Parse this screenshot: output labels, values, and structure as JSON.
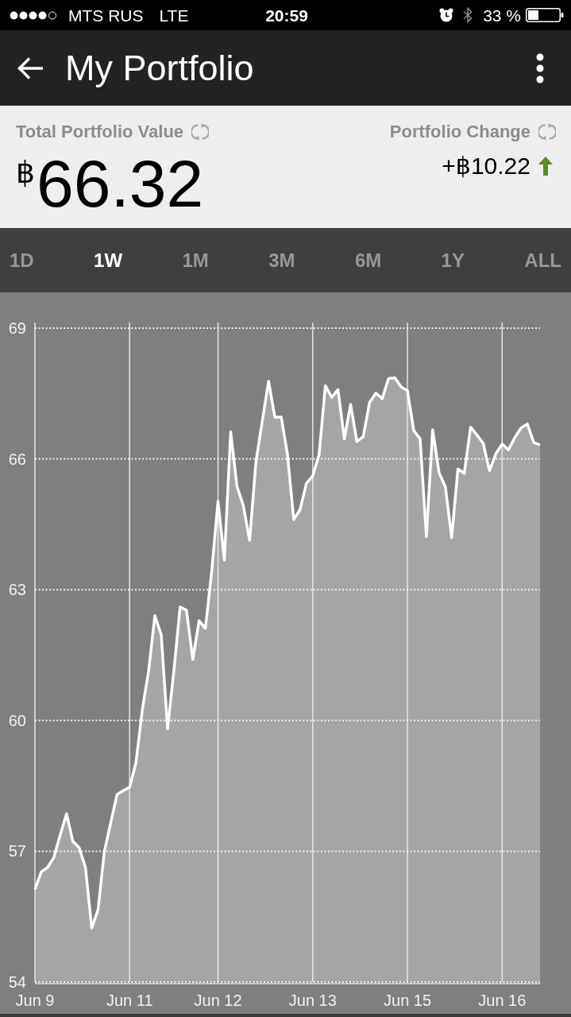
{
  "status_bar": {
    "carrier": "MTS RUS",
    "network": "LTE",
    "time": "20:59",
    "battery": "33 %"
  },
  "app_bar": {
    "title": "My Portfolio"
  },
  "summary": {
    "total": {
      "label": "Total Portfolio Value",
      "value": "$^{฿}$66.32"
    },
    "change": {
      "label": "Portfolio Change",
      "value": "+฿10.22"
    }
  },
  "range_tabs": [
    {
      "label": "1D",
      "selected": false
    },
    {
      "label": "1W",
      "selected": true
    },
    {
      "label": "1M",
      "selected": false
    },
    {
      "label": "3M",
      "selected": false
    },
    {
      "label": "6M",
      "selected": false
    },
    {
      "label": "1Y",
      "selected": false
    },
    {
      "label": "ALL",
      "selected": false
    }
  ],
  "chart": {
    "chart_data": {
      "type": "area",
      "grid": true,
      "categories": [
        "Jun 9",
        null,
        null,
        null,
        null,
        null,
        null,
        null,
        null,
        null,
        null,
        null,
        null,
        null,
        null,
        "Jun 11",
        null,
        null,
        null,
        null,
        null,
        null,
        null,
        null,
        null,
        null,
        null,
        null,
        null,
        "Jun 12",
        null,
        null,
        null,
        null,
        null,
        null,
        null,
        null,
        null,
        null,
        null,
        null,
        null,
        null,
        "Jun 13",
        null,
        null,
        null,
        null,
        null,
        null,
        null,
        null,
        null,
        null,
        null,
        null,
        null,
        null,
        "Jun 15",
        null,
        null,
        null,
        null,
        null,
        null,
        null,
        null,
        null,
        null,
        null,
        null,
        null,
        null,
        "Jun 16",
        null,
        null,
        null,
        null,
        null,
        null
      ],
      "series": [
        {
          "color": "#ffffff",
          "values": [
            56.12,
            56.53,
            56.63,
            56.86,
            57.37,
            57.86,
            57.23,
            57.08,
            56.63,
            55.24,
            55.66,
            56.99,
            57.65,
            58.3,
            58.39,
            58.47,
            59.03,
            60.25,
            61.13,
            62.4,
            61.97,
            59.81,
            61.13,
            62.6,
            62.53,
            61.4,
            62.29,
            62.11,
            63.42,
            65.03,
            63.68,
            66.62,
            65.37,
            64.94,
            64.13,
            65.94,
            66.86,
            67.78,
            66.96,
            66.96,
            66.1,
            64.61,
            64.84,
            65.44,
            65.61,
            66.1,
            67.68,
            67.41,
            67.59,
            66.46,
            67.25,
            66.4,
            66.51,
            67.29,
            67.51,
            67.38,
            67.84,
            67.86,
            67.65,
            67.57,
            66.65,
            66.46,
            64.22,
            66.67,
            65.69,
            65.36,
            64.19,
            65.77,
            65.67,
            66.73,
            66.55,
            66.36,
            65.73,
            66.12,
            66.34,
            66.21,
            66.49,
            66.71,
            66.8,
            66.38,
            66.32
          ]
        }
      ],
      "ylim": [
        54,
        69
      ],
      "yticks": [
        54,
        57,
        60,
        63,
        66,
        69
      ]
    }
  }
}
